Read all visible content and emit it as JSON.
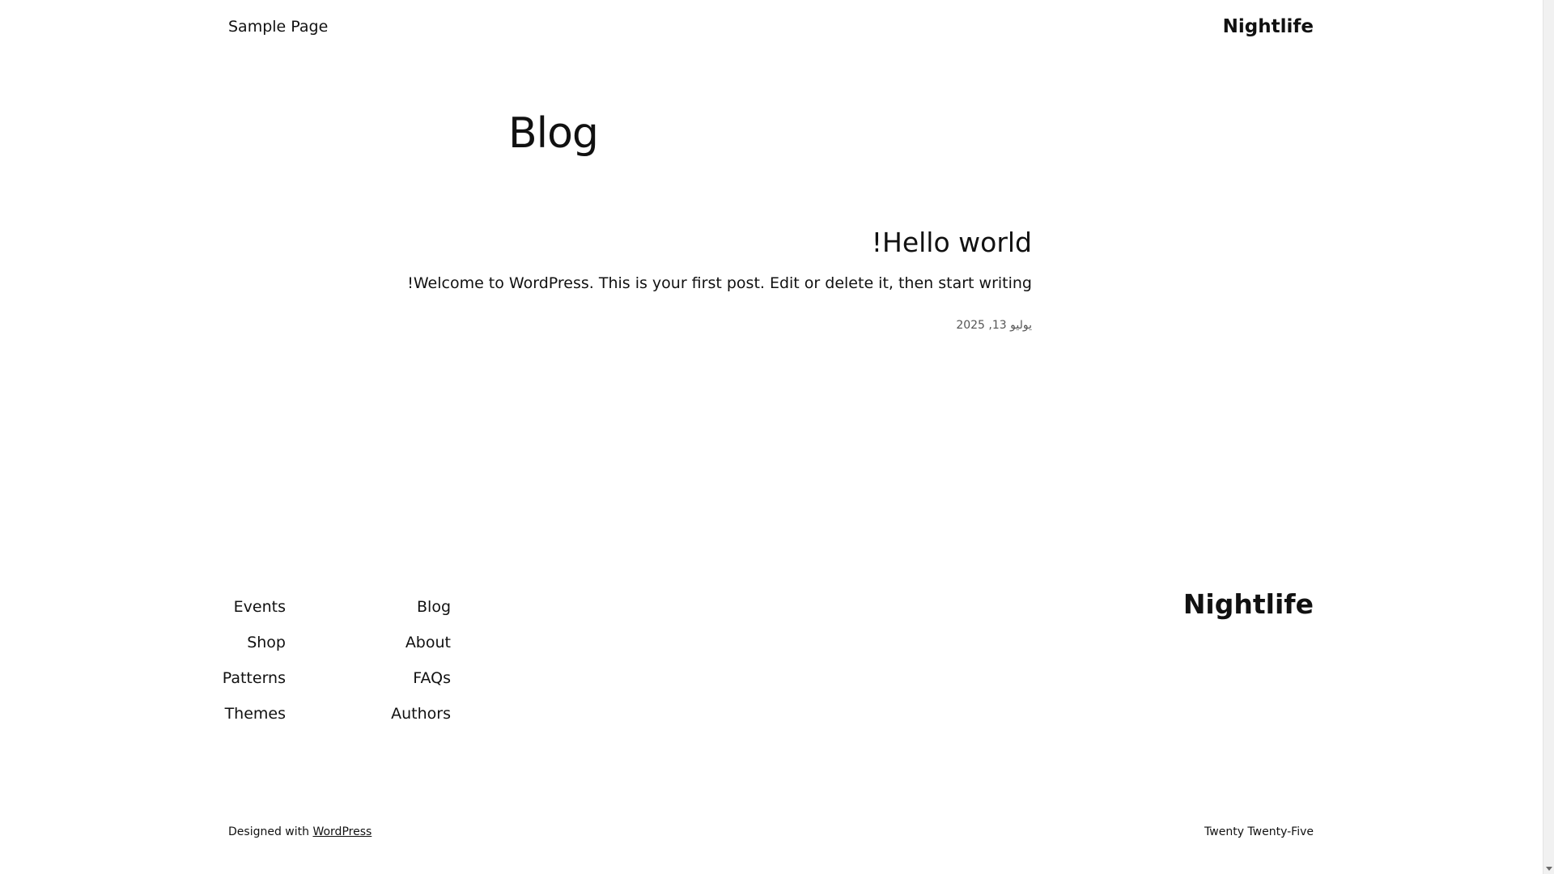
{
  "header": {
    "nav_sample_page": "Sample Page",
    "site_title": "Nightlife"
  },
  "main": {
    "page_title": "Blog",
    "post": {
      "title": "Hello world!",
      "excerpt": "Welcome to WordPress. This is your first post. Edit or delete it, then start writing!",
      "date": "يوليو 13, 2025"
    }
  },
  "footer": {
    "site_title": "Nightlife",
    "nav_col_1": [
      "Events",
      "Shop",
      "Patterns",
      "Themes"
    ],
    "nav_col_2": [
      "Blog",
      "About",
      "FAQs",
      "Authors"
    ],
    "credit_prefix": "Designed with",
    "credit_link": "WordPress",
    "theme_name": "Twenty Twenty-Five"
  },
  "colors": {
    "background": "#ffffff",
    "text": "#111111",
    "muted": "#555555"
  }
}
